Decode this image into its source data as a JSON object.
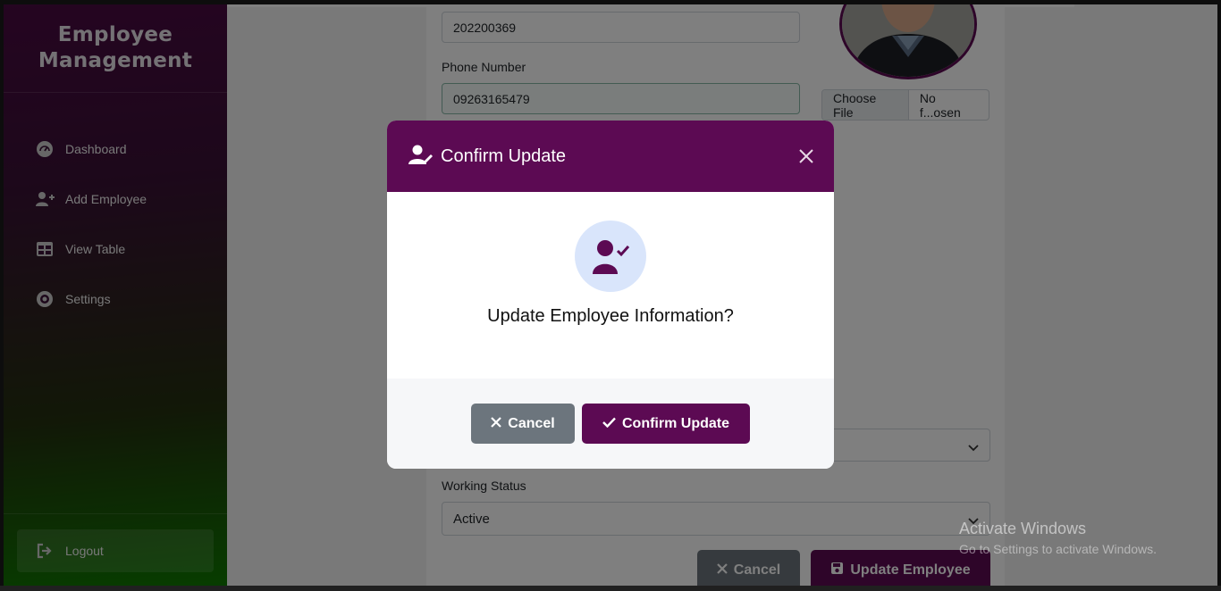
{
  "sidebar": {
    "brand": "Employee Management",
    "items": [
      {
        "label": "Dashboard",
        "icon": "dashboard-icon"
      },
      {
        "label": "Add Employee",
        "icon": "user-plus-icon"
      },
      {
        "label": "View Table",
        "icon": "table-icon"
      },
      {
        "label": "Settings",
        "icon": "gear-icon"
      }
    ],
    "logout": "Logout"
  },
  "form": {
    "employee_id_value": "202200369",
    "phone_label": "Phone Number",
    "phone_value": "09263165479",
    "file_button": "Choose File",
    "file_status": "No f...osen",
    "working_status_label": "Working Status",
    "working_status_value": "Active",
    "cancel_label": "Cancel",
    "update_label": "Update Employee"
  },
  "modal": {
    "title": "Confirm Update",
    "question": "Update Employee Information?",
    "cancel_label": "Cancel",
    "confirm_label": "Confirm Update"
  },
  "watermark": {
    "line1": "Activate Windows",
    "line2": "Go to Settings to activate Windows."
  },
  "colors": {
    "primary": "#5c0a53",
    "secondary": "#6c757d",
    "modal_icon_bg": "#d9e5fb"
  }
}
